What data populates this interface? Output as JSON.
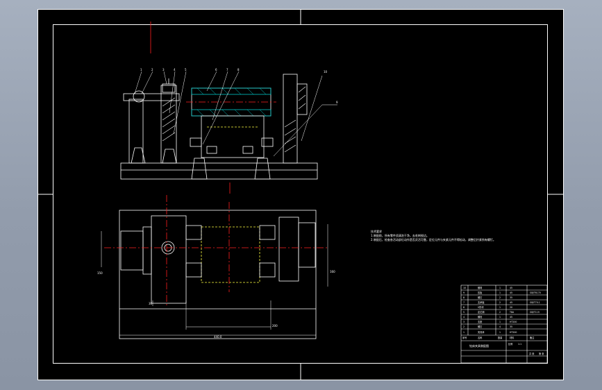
{
  "notes": {
    "title": "技术要求",
    "line1": "1.装配前，所有零件须清洗干净，去毛刺锐边。",
    "line2": "2.装配后，检查各活动部位动作是否灵活可靠，定位元件与夹紧元件不得松动，调整后拧紧所有螺钉。"
  },
  "balloons": [
    "1",
    "2",
    "3",
    "4",
    "5",
    "6",
    "7",
    "8",
    "9",
    "10"
  ],
  "dimensions": {
    "overall_length": "440.0",
    "inner_length": "200",
    "overall_width": "160",
    "left_height": "150",
    "small_dim": "30"
  },
  "bom_rows": [
    {
      "no": "10",
      "name": "螺母",
      "qty": "1",
      "mat": "45",
      "note": ""
    },
    {
      "no": "9",
      "name": "压板",
      "qty": "1",
      "mat": "45",
      "note": "GB/T6170"
    },
    {
      "no": "8",
      "name": "螺钉",
      "qty": "2",
      "mat": "35",
      "note": ""
    },
    {
      "no": "7",
      "name": "支承板",
      "qty": "2",
      "mat": "45",
      "note": "GB/T70.1"
    },
    {
      "no": "6",
      "name": "V形块",
      "qty": "1",
      "mat": "20",
      "note": ""
    },
    {
      "no": "5",
      "name": "定位销",
      "qty": "2",
      "mat": "T8A",
      "note": "GB/T119"
    },
    {
      "no": "4",
      "name": "螺栓",
      "qty": "1",
      "mat": "45",
      "note": ""
    },
    {
      "no": "3",
      "name": "支座",
      "qty": "1",
      "mat": "HT200",
      "note": ""
    },
    {
      "no": "2",
      "name": "螺钉",
      "qty": "4",
      "mat": "35",
      "note": ""
    },
    {
      "no": "1",
      "name": "夹具体",
      "qty": "1",
      "mat": "HT200",
      "note": ""
    }
  ],
  "title_block": {
    "header_no": "序号",
    "header_name": "名称",
    "header_qty": "数量",
    "header_mat": "材料",
    "header_note": "备注",
    "drawing_name": "钻床夹具装配图",
    "scale_label": "比例",
    "scale": "1:1",
    "sheet_label": "共 张",
    "sheet": "第 张"
  },
  "colors": {
    "background": "#000000",
    "outline": "#ffffff",
    "centerline": "#ff2020",
    "hatch": "#00c8c8",
    "hidden": "#ffff40",
    "window": "#9aa4b4"
  }
}
